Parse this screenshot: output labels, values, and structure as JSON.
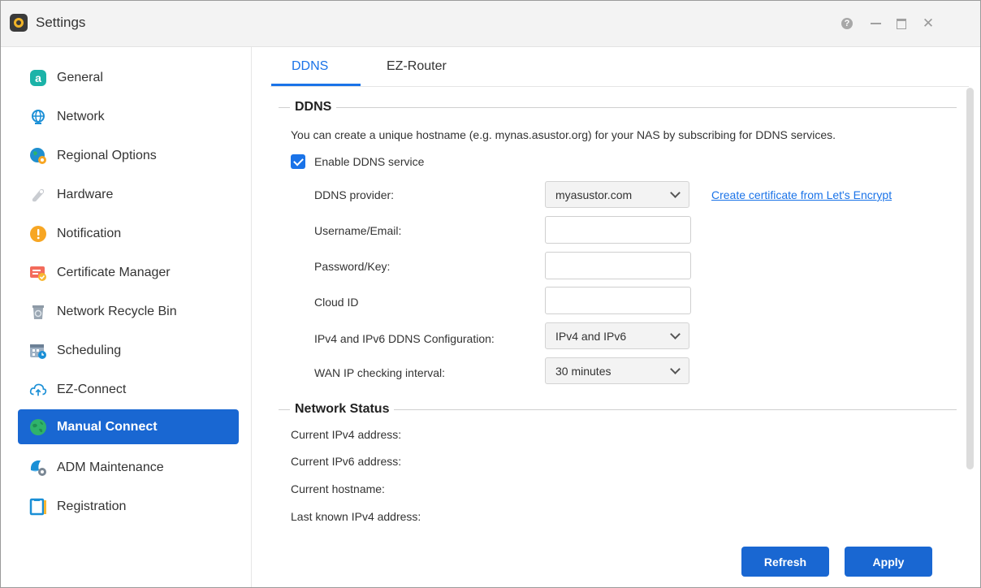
{
  "window": {
    "title": "Settings"
  },
  "sidebar": {
    "items": [
      {
        "label": "General",
        "icon": "general-icon",
        "active": false
      },
      {
        "label": "Network",
        "icon": "globe-icon",
        "active": false
      },
      {
        "label": "Regional Options",
        "icon": "regional-icon",
        "active": false
      },
      {
        "label": "Hardware",
        "icon": "hardware-icon",
        "active": false
      },
      {
        "label": "Notification",
        "icon": "notification-icon",
        "active": false
      },
      {
        "label": "Certificate Manager",
        "icon": "certificate-icon",
        "active": false
      },
      {
        "label": "Network Recycle Bin",
        "icon": "recycle-bin-icon",
        "active": false
      },
      {
        "label": "Scheduling",
        "icon": "calendar-icon",
        "active": false
      },
      {
        "label": "EZ-Connect",
        "icon": "cloud-icon",
        "active": false
      },
      {
        "label": "Manual Connect",
        "icon": "manual-connect-icon",
        "active": true
      },
      {
        "label": "ADM Maintenance",
        "icon": "maintenance-icon",
        "active": false
      },
      {
        "label": "Registration",
        "icon": "registration-icon",
        "active": false
      }
    ]
  },
  "tabs": [
    {
      "label": "DDNS",
      "active": true
    },
    {
      "label": "EZ-Router",
      "active": false
    }
  ],
  "ddns": {
    "section_title": "DDNS",
    "description": "You can create a unique hostname (e.g. mynas.asustor.org) for your NAS by subscribing for DDNS services.",
    "enable_label": "Enable DDNS service",
    "enable_checked": true,
    "provider_label": "DDNS provider:",
    "provider_value": "myasustor.com",
    "cert_link": "Create certificate from Let's Encrypt",
    "username_label": "Username/Email:",
    "username_value": "",
    "password_label": "Password/Key:",
    "password_value": "",
    "cloud_id_label": "Cloud ID",
    "cloud_id_value": "",
    "ip_config_label": "IPv4 and IPv6 DDNS Configuration:",
    "ip_config_value": "IPv4 and IPv6",
    "interval_label": "WAN IP checking interval:",
    "interval_value": "30 minutes"
  },
  "network_status": {
    "section_title": "Network Status",
    "ipv4_label": "Current IPv4 address:",
    "ipv6_label": "Current IPv6 address:",
    "hostname_label": "Current hostname:",
    "last_ipv4_label": "Last known IPv4 address:"
  },
  "buttons": {
    "refresh": "Refresh",
    "apply": "Apply"
  },
  "colors": {
    "accent": "#1967d2",
    "link": "#1a73e8"
  }
}
